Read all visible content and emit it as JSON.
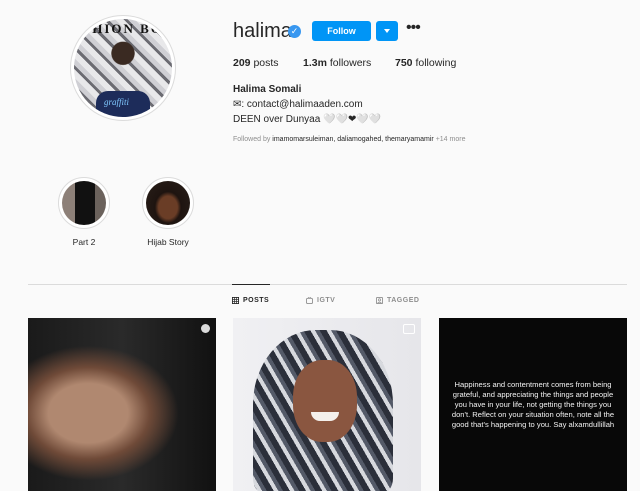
{
  "profile": {
    "username": "halima",
    "verified_icon": "verified-badge-icon",
    "follow_label": "Follow",
    "more_icon": "•••",
    "stats": {
      "posts_count": "209",
      "posts_label": "posts",
      "followers_count": "1.3m",
      "followers_label": "followers",
      "following_count": "750",
      "following_label": "following"
    },
    "full_name": "Halima Somali",
    "bio_line1": "✉: contact@halimaaden.com",
    "bio_line2": "DEEN over Dunyaa 🤍🤍❤🤍🤍",
    "followed_by_prefix": "Followed by ",
    "followed_by_names": "imamomarsuleiman, daliamogahed, themaryamamir",
    "followed_by_more": " +14 more",
    "avatar_text": "SHION BO",
    "avatar_shirt_text": "graffiti"
  },
  "highlights": [
    {
      "label": "Part 2"
    },
    {
      "label": "Hijab Story"
    }
  ],
  "tabs": [
    {
      "label": "POSTS",
      "icon": "grid-icon",
      "active": true
    },
    {
      "label": "IGTV",
      "icon": "igtv-icon",
      "active": false
    },
    {
      "label": "TAGGED",
      "icon": "tagged-icon",
      "active": false
    }
  ],
  "posts": [
    {
      "type": "video"
    },
    {
      "type": "carousel"
    },
    {
      "type": "text",
      "text": "Happiness and contentment comes from being grateful, and appreciating the things and people you have in your life, not getting the things you don't. Reflect on your situation often, note all the good that's happening to you. Say alxamdullillah"
    }
  ],
  "colors": {
    "accent": "#0095f6",
    "background": "#fafafa",
    "text": "#262626",
    "secondary_text": "#8e8e8e"
  }
}
